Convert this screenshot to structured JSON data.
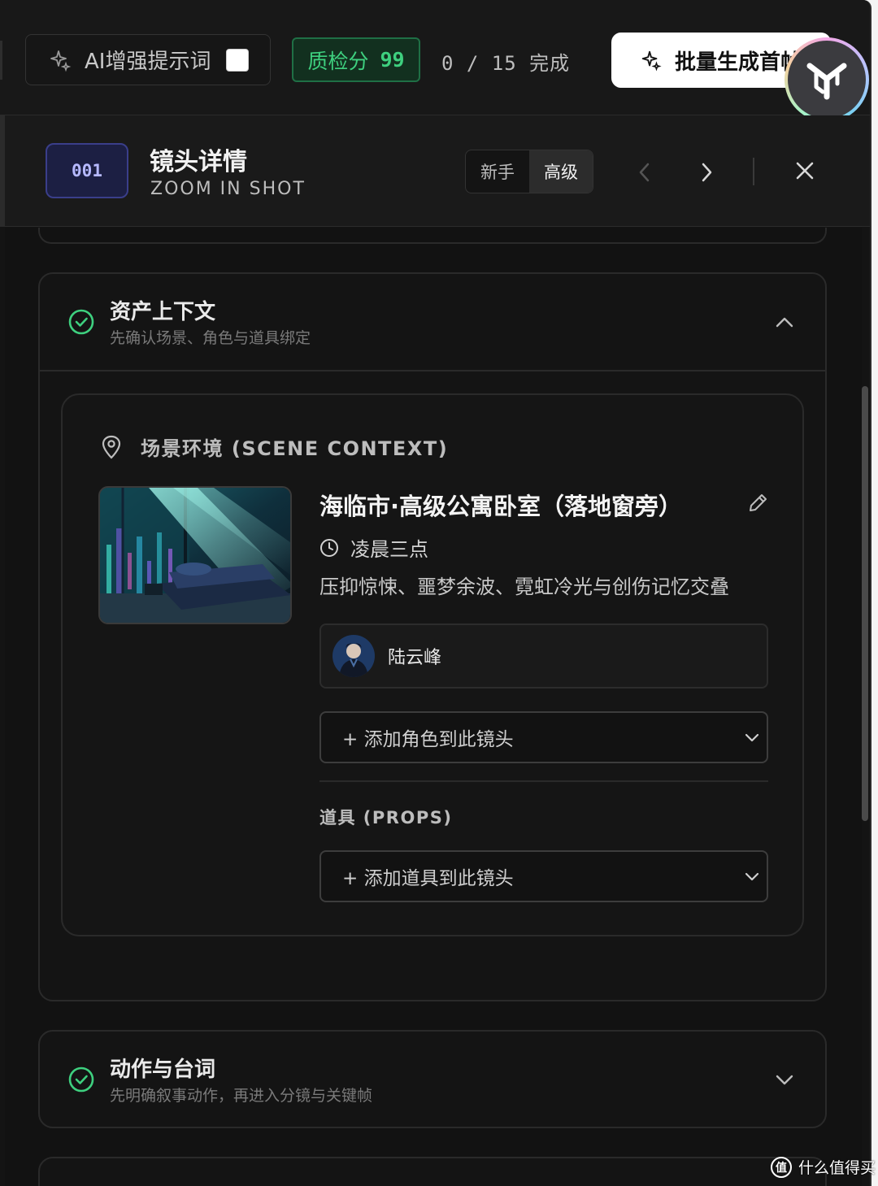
{
  "toolbar": {
    "ai_enhance_label": "AI增强提示词",
    "ai_enhance_checked": false,
    "qc_label": "质检分",
    "qc_score": "99",
    "progress_text": "0 / 15 完成",
    "batch_button_label": "批量生成首帧",
    "accent_green": "#3ed07f"
  },
  "shot": {
    "id": "001",
    "title": "镜头详情",
    "subtitle": "ZOOM IN SHOT",
    "modes": [
      "新手",
      "高级"
    ],
    "active_mode": "高级"
  },
  "asset_section": {
    "title": "资产上下文",
    "description": "先确认场景、角色与道具绑定",
    "expanded": true,
    "scene": {
      "label": "场景环境 (SCENE CONTEXT)",
      "location": "海临市·高级公寓卧室（落地窗旁）",
      "time": "凌晨三点",
      "mood": "压抑惊悚、噩梦余波、霓虹冷光与创伤记忆交叠",
      "character": "陆云峰",
      "add_character_placeholder": "+ 添加角色到此镜头",
      "props_label": "道具 (PROPS)",
      "add_prop_placeholder": "+ 添加道具到此镜头"
    }
  },
  "action_section": {
    "title": "动作与台词",
    "description": "先明确叙事动作，再进入分镜与关键帧",
    "expanded": false
  },
  "watermark": {
    "text": "什么值得买",
    "icon_text": "值"
  }
}
